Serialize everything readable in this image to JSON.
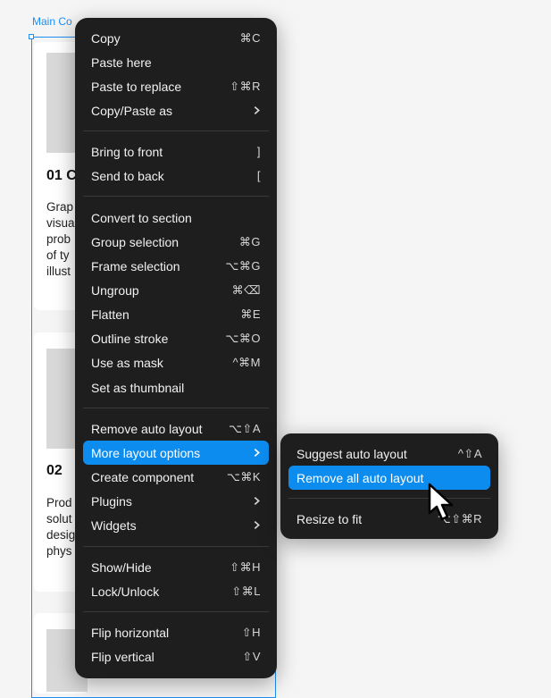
{
  "canvas": {
    "frame_label": "Main Co",
    "cards": [
      {
        "number": "01 C",
        "desc": [
          "Grap",
          "visua",
          "prob",
          "of ty",
          "illust"
        ]
      },
      {
        "number": "02",
        "desc": [
          "Prod",
          "solut",
          "desig",
          "phys"
        ]
      }
    ]
  },
  "menu": {
    "items": [
      {
        "label": "Copy",
        "shortcut": "⌘C"
      },
      {
        "label": "Paste here",
        "shortcut": ""
      },
      {
        "label": "Paste to replace",
        "shortcut": "⇧⌘R"
      },
      {
        "label": "Copy/Paste as",
        "shortcut": ""
      },
      {
        "label": "Bring to front",
        "shortcut": "]"
      },
      {
        "label": "Send to back",
        "shortcut": "["
      },
      {
        "label": "Convert to section",
        "shortcut": ""
      },
      {
        "label": "Group selection",
        "shortcut": "⌘G"
      },
      {
        "label": "Frame selection",
        "shortcut": "⌥⌘G"
      },
      {
        "label": "Ungroup",
        "shortcut": "⌘⌫"
      },
      {
        "label": "Flatten",
        "shortcut": "⌘E"
      },
      {
        "label": "Outline stroke",
        "shortcut": "⌥⌘O"
      },
      {
        "label": "Use as mask",
        "shortcut": "^⌘M"
      },
      {
        "label": "Set as thumbnail",
        "shortcut": ""
      },
      {
        "label": "Remove auto layout",
        "shortcut": "⌥⇧A"
      },
      {
        "label": "More layout options",
        "shortcut": ""
      },
      {
        "label": "Create component",
        "shortcut": "⌥⌘K"
      },
      {
        "label": "Plugins",
        "shortcut": ""
      },
      {
        "label": "Widgets",
        "shortcut": ""
      },
      {
        "label": "Show/Hide",
        "shortcut": "⇧⌘H"
      },
      {
        "label": "Lock/Unlock",
        "shortcut": "⇧⌘L"
      },
      {
        "label": "Flip horizontal",
        "shortcut": "⇧H"
      },
      {
        "label": "Flip vertical",
        "shortcut": "⇧V"
      }
    ]
  },
  "submenu": {
    "items": [
      {
        "label": "Suggest auto layout",
        "shortcut": "^⇧A"
      },
      {
        "label": "Remove all auto layout",
        "shortcut": ""
      },
      {
        "label": "Resize to fit",
        "shortcut": "⌥⇧⌘R"
      }
    ]
  },
  "colors": {
    "accent": "#0d8cf0",
    "menu_bg": "#1e1e1e",
    "selection": "#1e8ef2"
  }
}
